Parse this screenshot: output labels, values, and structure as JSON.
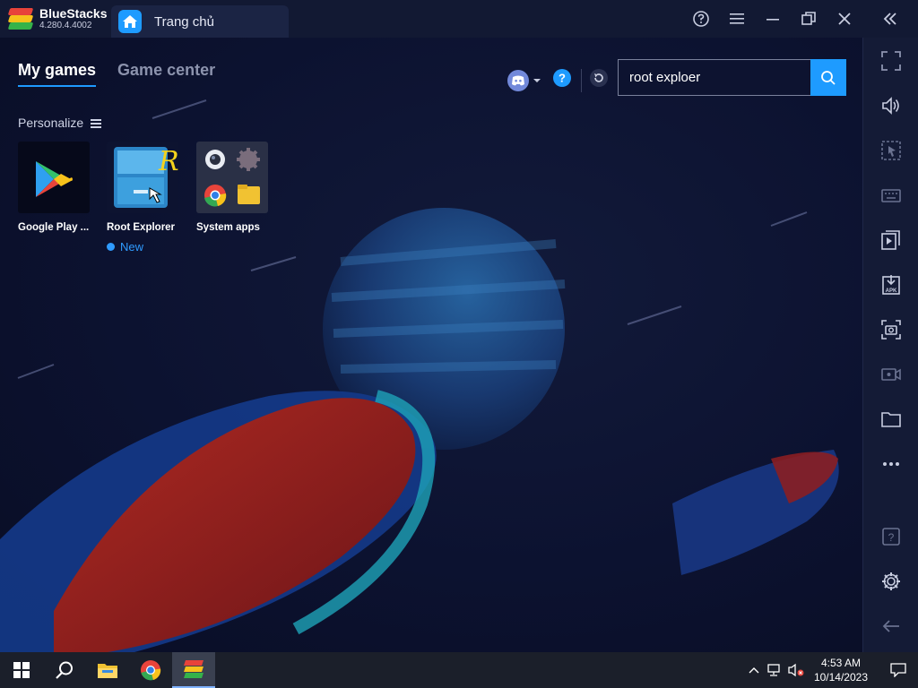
{
  "window": {
    "app_name": "BlueStacks",
    "version": "4.280.4.4002",
    "tab_title": "Trang chủ"
  },
  "nav": {
    "tabs": [
      {
        "label": "My games",
        "active": true
      },
      {
        "label": "Game center",
        "active": false
      }
    ]
  },
  "personalize_label": "Personalize",
  "search": {
    "value": "root exploer"
  },
  "apps": [
    {
      "label": "Google Play ...",
      "icon": "google-play-icon"
    },
    {
      "label": "Root Explorer",
      "icon": "root-explorer-icon",
      "badge": "New"
    },
    {
      "label": "System apps",
      "icon": "system-apps-folder-icon"
    }
  ],
  "sidebar_icons": [
    "fullscreen-icon",
    "volume-icon",
    "pointer-lock-icon",
    "keyboard-icon",
    "media-manager-icon",
    "install-apk-icon",
    "screenshot-icon",
    "record-icon",
    "folder-icon",
    "more-icon",
    "help-icon",
    "settings-icon",
    "back-icon"
  ],
  "taskbar": {
    "time": "4:53 AM",
    "date": "10/14/2023"
  },
  "colors": {
    "accent": "#1e9bff",
    "background": "#0b1128",
    "titlebar": "#121933",
    "new_badge": "#2f9bff"
  }
}
